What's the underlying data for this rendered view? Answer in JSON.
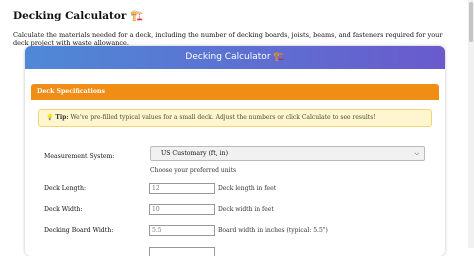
{
  "page": {
    "title": "Decking Calculator 🏗️",
    "intro": "Calculate the materials needed for a deck, including the number of decking boards, joists, beams, and fasteners required for your deck project with waste allowance."
  },
  "card": {
    "header": "Decking Calculator 🏗️",
    "section_title": "Deck Specifications",
    "tip": {
      "icon": "💡",
      "label": "Tip:",
      "text": "We've pre-filled typical values for a small deck. Adjust the numbers or click Calculate to see results!"
    },
    "measurement": {
      "label": "Measurement System:",
      "selected": "US Customary (ft, in)",
      "hint": "Choose your preferred units"
    },
    "length": {
      "label": "Deck Length:",
      "value": "12",
      "unit": "Deck length in feet"
    },
    "width": {
      "label": "Deck Width:",
      "value": "10",
      "unit": "Deck width in feet"
    },
    "board_width": {
      "label": "Decking Board Width:",
      "value": "5.5",
      "unit": "Board width in inches (typical: 5.5\")"
    }
  }
}
